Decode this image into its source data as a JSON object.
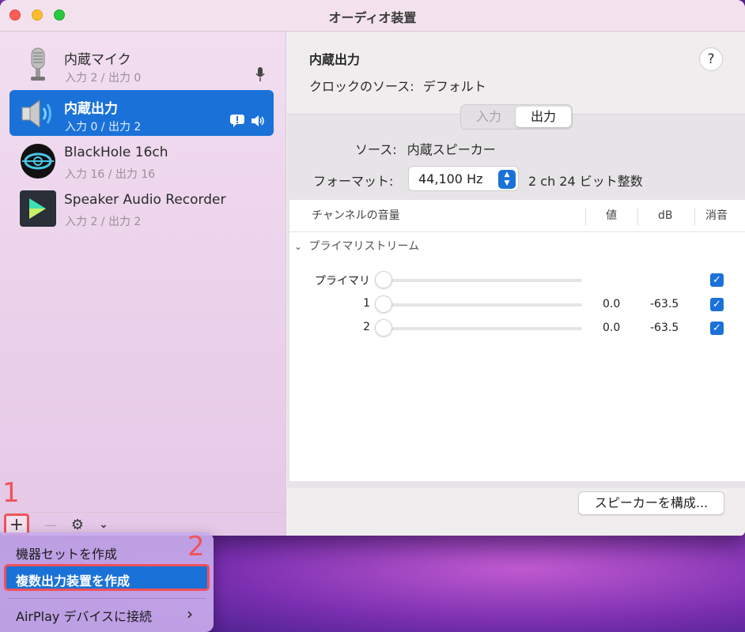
{
  "window": {
    "title": "オーディオ装置"
  },
  "sidebar": {
    "devices": [
      {
        "name": "内蔵マイク",
        "io": "入力 2 / 出力 0",
        "icon": "microphone-icon"
      },
      {
        "name": "内蔵出力",
        "io": "入力 0 / 出力 2",
        "icon": "speaker-icon",
        "selected": true
      },
      {
        "name": "BlackHole 16ch",
        "io": "入力 16 / 出力 16",
        "icon": "blackhole-icon"
      },
      {
        "name": "Speaker Audio Recorder",
        "io": "入力 2 / 出力 2",
        "icon": "recorder-app-icon"
      }
    ],
    "toolbar": {
      "add": "+",
      "remove": "—",
      "settings": "⚙",
      "menu": "⌄"
    }
  },
  "main": {
    "title": "内蔵出力",
    "clock_label": "クロックのソース:",
    "clock_value": "デフォルト",
    "help": "?",
    "tabs": {
      "input": "入力",
      "output": "出力",
      "selected": "output"
    },
    "source_label": "ソース:",
    "source_value": "内蔵スピーカー",
    "format_label": "フォーマット:",
    "format_value": "44,100 Hz",
    "format_desc": "2 ch 24 ビット整数",
    "table": {
      "col_channel": "チャンネルの音量",
      "col_value": "値",
      "col_db": "dB",
      "col_mute": "消音",
      "group": "プライマリストリーム",
      "rows": [
        {
          "name": "プライマリ",
          "value": "",
          "db": "",
          "mute": true
        },
        {
          "name": "1",
          "value": "0.0",
          "db": "-63.5",
          "mute": true
        },
        {
          "name": "2",
          "value": "0.0",
          "db": "-63.5",
          "mute": true
        }
      ]
    },
    "speaker_button": "スピーカーを構成..."
  },
  "menu": {
    "items": [
      {
        "label": "機器セットを作成"
      },
      {
        "label": "複数出力装置を作成"
      },
      {
        "label": "AirPlay デバイスに接続",
        "chevron": "›"
      }
    ]
  },
  "steps": {
    "one": "1",
    "two": "2"
  },
  "colors": {
    "accent": "#1a72d8",
    "highlight": "#f0525a"
  }
}
